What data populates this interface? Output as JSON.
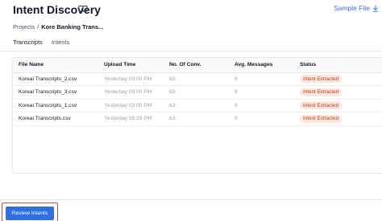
{
  "header": {
    "title": "Intent Discovery",
    "title_icon": "book-icon",
    "sample_file_label": "Sample File",
    "sample_file_icon": "download-icon",
    "accent_color": "#3b6fe0"
  },
  "breadcrumb": {
    "root": "Projects",
    "separator": "/",
    "current": "Kore Banking Trans..."
  },
  "tabs": [
    {
      "label": "Transcripts",
      "active": true
    },
    {
      "label": "Intents",
      "active": false
    }
  ],
  "table": {
    "columns": [
      "File Name",
      "Upload Time",
      "No. Of Conv.",
      "Avg. Messages",
      "Status"
    ],
    "rows": [
      {
        "file_name": "Koreai Transcripts_2.csv",
        "upload_time": "Yesterday 03:00 PM",
        "conversations": "63",
        "avg_messages": "8",
        "status": "Intent Extracted"
      },
      {
        "file_name": "Koreai Transcripts_3.csv",
        "upload_time": "Yesterday 03:00 PM",
        "conversations": "63",
        "avg_messages": "8",
        "status": "Intent Extracted"
      },
      {
        "file_name": "Koreai Transcripts_1.csv",
        "upload_time": "Yesterday 03:00 PM",
        "conversations": "63",
        "avg_messages": "8",
        "status": "Intent Extracted"
      },
      {
        "file_name": "Koreai Transcripts.csv",
        "upload_time": "Yesterday 05:29 PM",
        "conversations": "63",
        "avg_messages": "8",
        "status": "Intent Extracted"
      }
    ],
    "status_color": "#fde6e1"
  },
  "footer": {
    "review_button_label": "Review Intents",
    "button_color": "#2f6fe4",
    "highlight_color": "#e0403b"
  }
}
